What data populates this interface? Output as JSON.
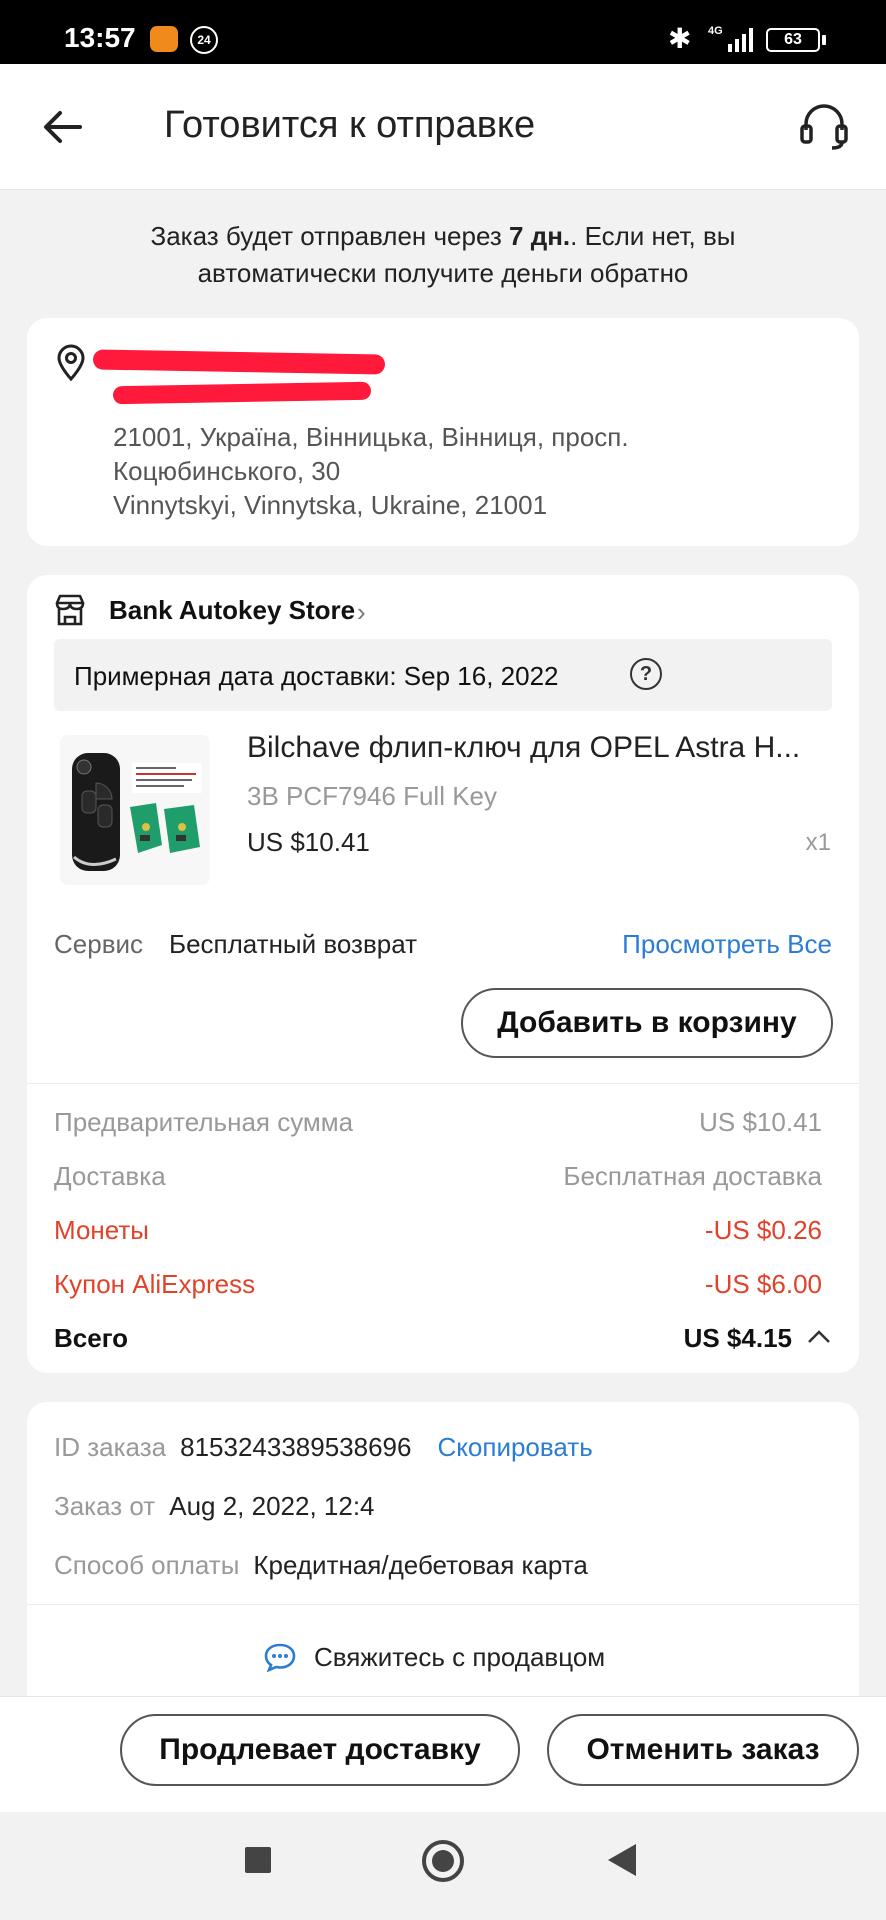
{
  "status_bar": {
    "time": "13:57",
    "notif_badge": "24",
    "network": "4G",
    "battery": "63"
  },
  "header": {
    "title": "Готовится к отправке"
  },
  "notice": {
    "before": "Заказ будет отправлен через ",
    "days": "7 дн.",
    "after": ". Если нет, вы автоматически получите деньги обратно"
  },
  "address": {
    "line1": "21001, Україна, Вінницька, Вінниця, просп.",
    "line2": "Коцюбинського, 30",
    "line3": "Vinnytskyi, Vinnytska, Ukraine, 21001"
  },
  "store": {
    "name": "Bank Autokey Store"
  },
  "delivery": {
    "text": "Примерная дата доставки: Sep 16, 2022"
  },
  "product": {
    "title": "Bilchave флип-ключ для OPEL Astra H...",
    "variant": "3B PCF7946 Full Key",
    "price": "US $10.41",
    "qty": "x1"
  },
  "service": {
    "label": "Сервис",
    "value": "Бесплатный возврат",
    "view_all": "Просмотреть Все"
  },
  "buttons": {
    "add_to_cart": "Добавить в корзину",
    "extend_delivery": "Продлевает доставку",
    "cancel_order": "Отменить заказ"
  },
  "summary": {
    "subtotal_label": "Предварительная сумма",
    "subtotal_value": "US $10.41",
    "shipping_label": "Доставка",
    "shipping_value": "Бесплатная доставка",
    "coins_label": "Монеты",
    "coins_value": "-US $0.26",
    "coupon_label": "Купон AliExpress",
    "coupon_value": "-US $6.00",
    "total_label": "Всего",
    "total_value": "US $4.15"
  },
  "order_info": {
    "id_label": "ID заказа",
    "id_value": "8153243389538696",
    "copy": "Скопировать",
    "date_label": "Заказ от",
    "date_value": "Aug 2, 2022, 12:4",
    "payment_label": "Способ оплаты",
    "payment_value": "Кредитная/дебетовая карта",
    "contact": "Свяжитесь с продавцом"
  },
  "colors": {
    "accent_blue": "#2b7dd4",
    "discount_red": "#e0422a",
    "redaction": "#ff1a3c"
  }
}
